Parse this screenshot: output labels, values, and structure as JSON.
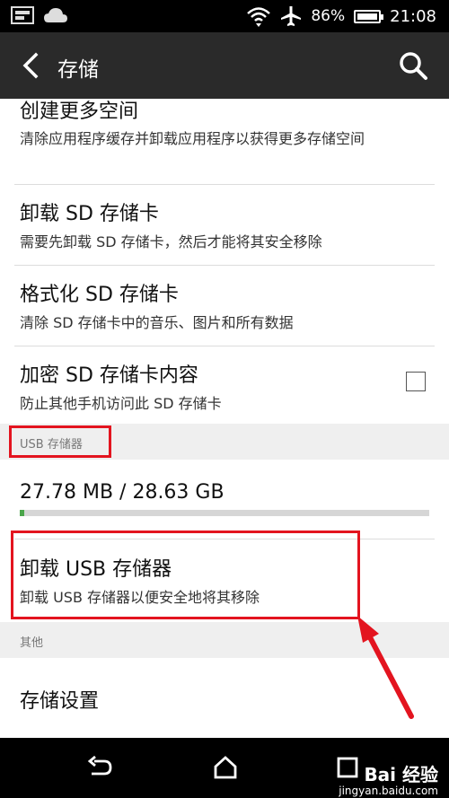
{
  "status_bar": {
    "battery_text": "86%",
    "time": "21:08"
  },
  "action_bar": {
    "title": "存储"
  },
  "items": {
    "create_space": {
      "title": "创建更多空间",
      "subtitle": "清除应用程序缓存并卸载应用程序以获得更多存储空间"
    },
    "unmount_sd": {
      "title": "卸载 SD 存储卡",
      "subtitle": "需要先卸载 SD 存储卡，然后才能将其安全移除"
    },
    "format_sd": {
      "title": "格式化 SD 存储卡",
      "subtitle": "清除 SD 存储卡中的音乐、图片和所有数据"
    },
    "encrypt_sd": {
      "title": "加密 SD 存储卡内容",
      "subtitle": "防止其他手机访问此 SD 存储卡",
      "checked": false
    }
  },
  "usb_section": {
    "header": "USB 存储器",
    "usage_text": "27.78 MB / 28.63 GB",
    "usage_fraction": 0.001,
    "unmount_title": "卸载 USB 存储器",
    "unmount_subtitle": "卸载 USB 存储器以便安全地将其移除"
  },
  "other_section": {
    "header": "其他",
    "storage_settings": "存储设置"
  },
  "watermark": {
    "logo": "Bai 经验",
    "url": "jingyan.baidu.com"
  },
  "colors": {
    "highlight": "#e3141f",
    "progress": "#4aa54a",
    "action_bar": "#2a2a2a"
  },
  "icons": [
    "gallery-icon",
    "cloud-icon",
    "wifi-icon",
    "airplane-icon",
    "battery-icon",
    "back-arrow-icon",
    "search-icon",
    "nav-back-icon",
    "nav-home-icon",
    "nav-recent-icon"
  ]
}
